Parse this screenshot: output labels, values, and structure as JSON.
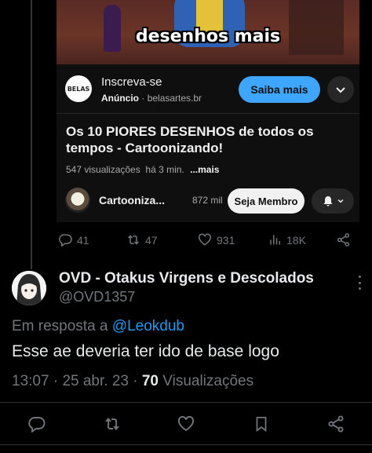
{
  "embed": {
    "thumbnail_caption": "desenhos mais",
    "ad": {
      "logo_text": "BELAS",
      "title": "Inscreva-se",
      "label": "Anúncio",
      "separator": "·",
      "domain": "belasartes.br",
      "cta_label": "Saiba mais"
    },
    "video": {
      "title": "Os 10 PIORES DESENHOS de todos os tempos - Cartoonizando!",
      "views": "547 visualizações",
      "age": "há 3 min.",
      "more_label": "...mais"
    },
    "channel": {
      "name": "Cartooniza...",
      "subscribers": "872 mil",
      "join_label": "Seja Membro"
    }
  },
  "parent_actions": {
    "replies": "41",
    "retweets": "47",
    "likes": "931",
    "views": "18K"
  },
  "reply": {
    "display_name": "OVD - Otakus Virgens e Descolados",
    "handle": "@OVD1357",
    "reply_prefix": "Em resposta a",
    "reply_to": "@Leokdub",
    "text": "Esse ae deveria ter ido de base logo",
    "time": "13:07",
    "date": "25 abr. 23",
    "views_count": "70",
    "views_label": "Visualizações"
  },
  "colors": {
    "background": "#000000",
    "text": "#e7e9ea",
    "muted": "#71767b",
    "accent": "#1d9bf0",
    "youtube_blue": "#3ea6ff"
  },
  "icons": [
    "reply-icon",
    "retweet-icon",
    "like-icon",
    "views-icon",
    "share-icon",
    "bookmark-icon",
    "bell-icon",
    "chevron-down-icon",
    "more-icon"
  ]
}
